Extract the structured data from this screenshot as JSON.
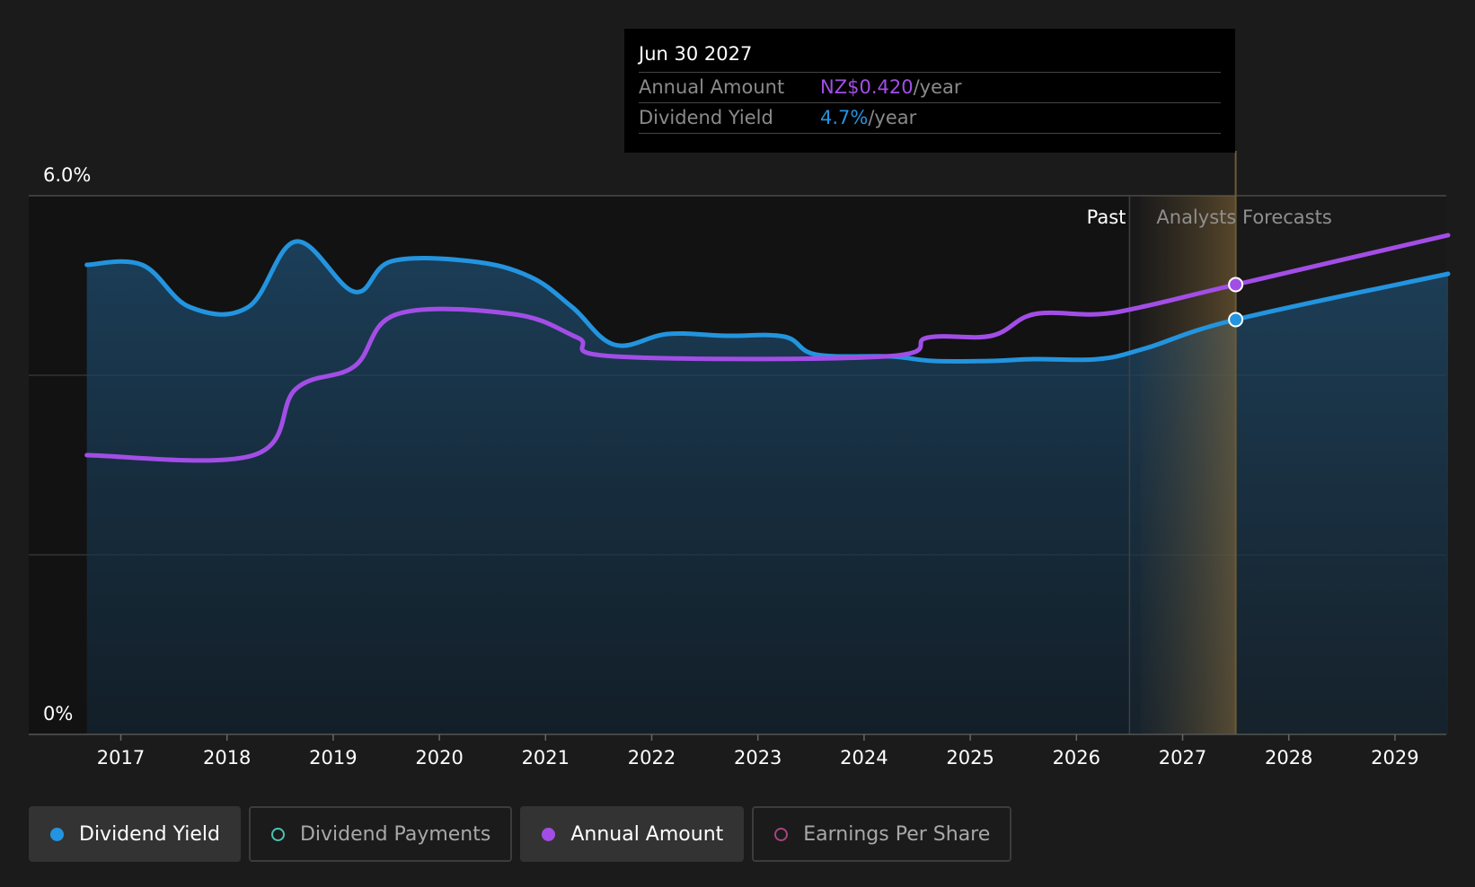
{
  "chart_data": {
    "type": "line",
    "ytick_labels": [
      "6.0%",
      "0%"
    ],
    "ylim": [
      0,
      6.0
    ],
    "xlim": [
      2016.55,
      2029.5
    ],
    "x_ticks": [
      2017,
      2018,
      2019,
      2020,
      2021,
      2022,
      2023,
      2024,
      2025,
      2026,
      2027,
      2028,
      2029
    ],
    "x_tick_labels": [
      "2017",
      "2018",
      "2019",
      "2020",
      "2021",
      "2022",
      "2023",
      "2024",
      "2025",
      "2026",
      "2027",
      "2028",
      "2029"
    ],
    "grid": true,
    "region_labels": {
      "past": "Past",
      "forecast": "Analysts Forecasts"
    },
    "past_end": 2026.5,
    "highlight_x": 2027.5,
    "series": [
      {
        "name": "Dividend Yield",
        "color": "#2394df",
        "area": true,
        "points": [
          [
            2016.68,
            5.23
          ],
          [
            2017.2,
            5.23
          ],
          [
            2017.65,
            4.76
          ],
          [
            2018.2,
            4.76
          ],
          [
            2018.65,
            5.49
          ],
          [
            2019.2,
            4.93
          ],
          [
            2019.55,
            5.27
          ],
          [
            2020.3,
            5.27
          ],
          [
            2020.85,
            5.1
          ],
          [
            2021.25,
            4.76
          ],
          [
            2021.65,
            4.34
          ],
          [
            2022.15,
            4.46
          ],
          [
            2022.7,
            4.44
          ],
          [
            2023.25,
            4.43
          ],
          [
            2023.55,
            4.23
          ],
          [
            2024.25,
            4.21
          ],
          [
            2024.65,
            4.16
          ],
          [
            2025.2,
            4.16
          ],
          [
            2025.6,
            4.18
          ],
          [
            2026.2,
            4.18
          ],
          [
            2026.65,
            4.3
          ],
          [
            2027.5,
            4.62
          ],
          [
            2029.5,
            5.13
          ]
        ]
      },
      {
        "name": "Annual Amount",
        "color": "#a24ee6",
        "area": false,
        "points": [
          [
            2016.68,
            3.11
          ],
          [
            2018.25,
            3.11
          ],
          [
            2018.65,
            3.85
          ],
          [
            2019.2,
            4.1
          ],
          [
            2019.6,
            4.68
          ],
          [
            2020.7,
            4.68
          ],
          [
            2021.3,
            4.42
          ],
          [
            2021.65,
            4.21
          ],
          [
            2024.2,
            4.21
          ],
          [
            2024.6,
            4.42
          ],
          [
            2025.2,
            4.44
          ],
          [
            2025.6,
            4.68
          ],
          [
            2026.2,
            4.68
          ],
          [
            2026.65,
            4.77
          ],
          [
            2027.5,
            5.01
          ],
          [
            2029.5,
            5.56
          ]
        ]
      }
    ],
    "tooltip": {
      "date": "Jun 30 2027",
      "rows": [
        {
          "label": "Annual Amount",
          "value": "NZ$0.420",
          "unit": "/year",
          "color": "#a24ee6"
        },
        {
          "label": "Dividend Yield",
          "value": "4.7%",
          "unit": "/year",
          "color": "#2394df"
        }
      ]
    },
    "legend": [
      {
        "label": "Dividend Yield",
        "color": "#2394df",
        "active": true
      },
      {
        "label": "Dividend Payments",
        "color": "#4bc3b0",
        "active": false
      },
      {
        "label": "Annual Amount",
        "color": "#a24ee6",
        "active": true
      },
      {
        "label": "Earnings Per Share",
        "color": "#a8447e",
        "active": false
      }
    ]
  }
}
